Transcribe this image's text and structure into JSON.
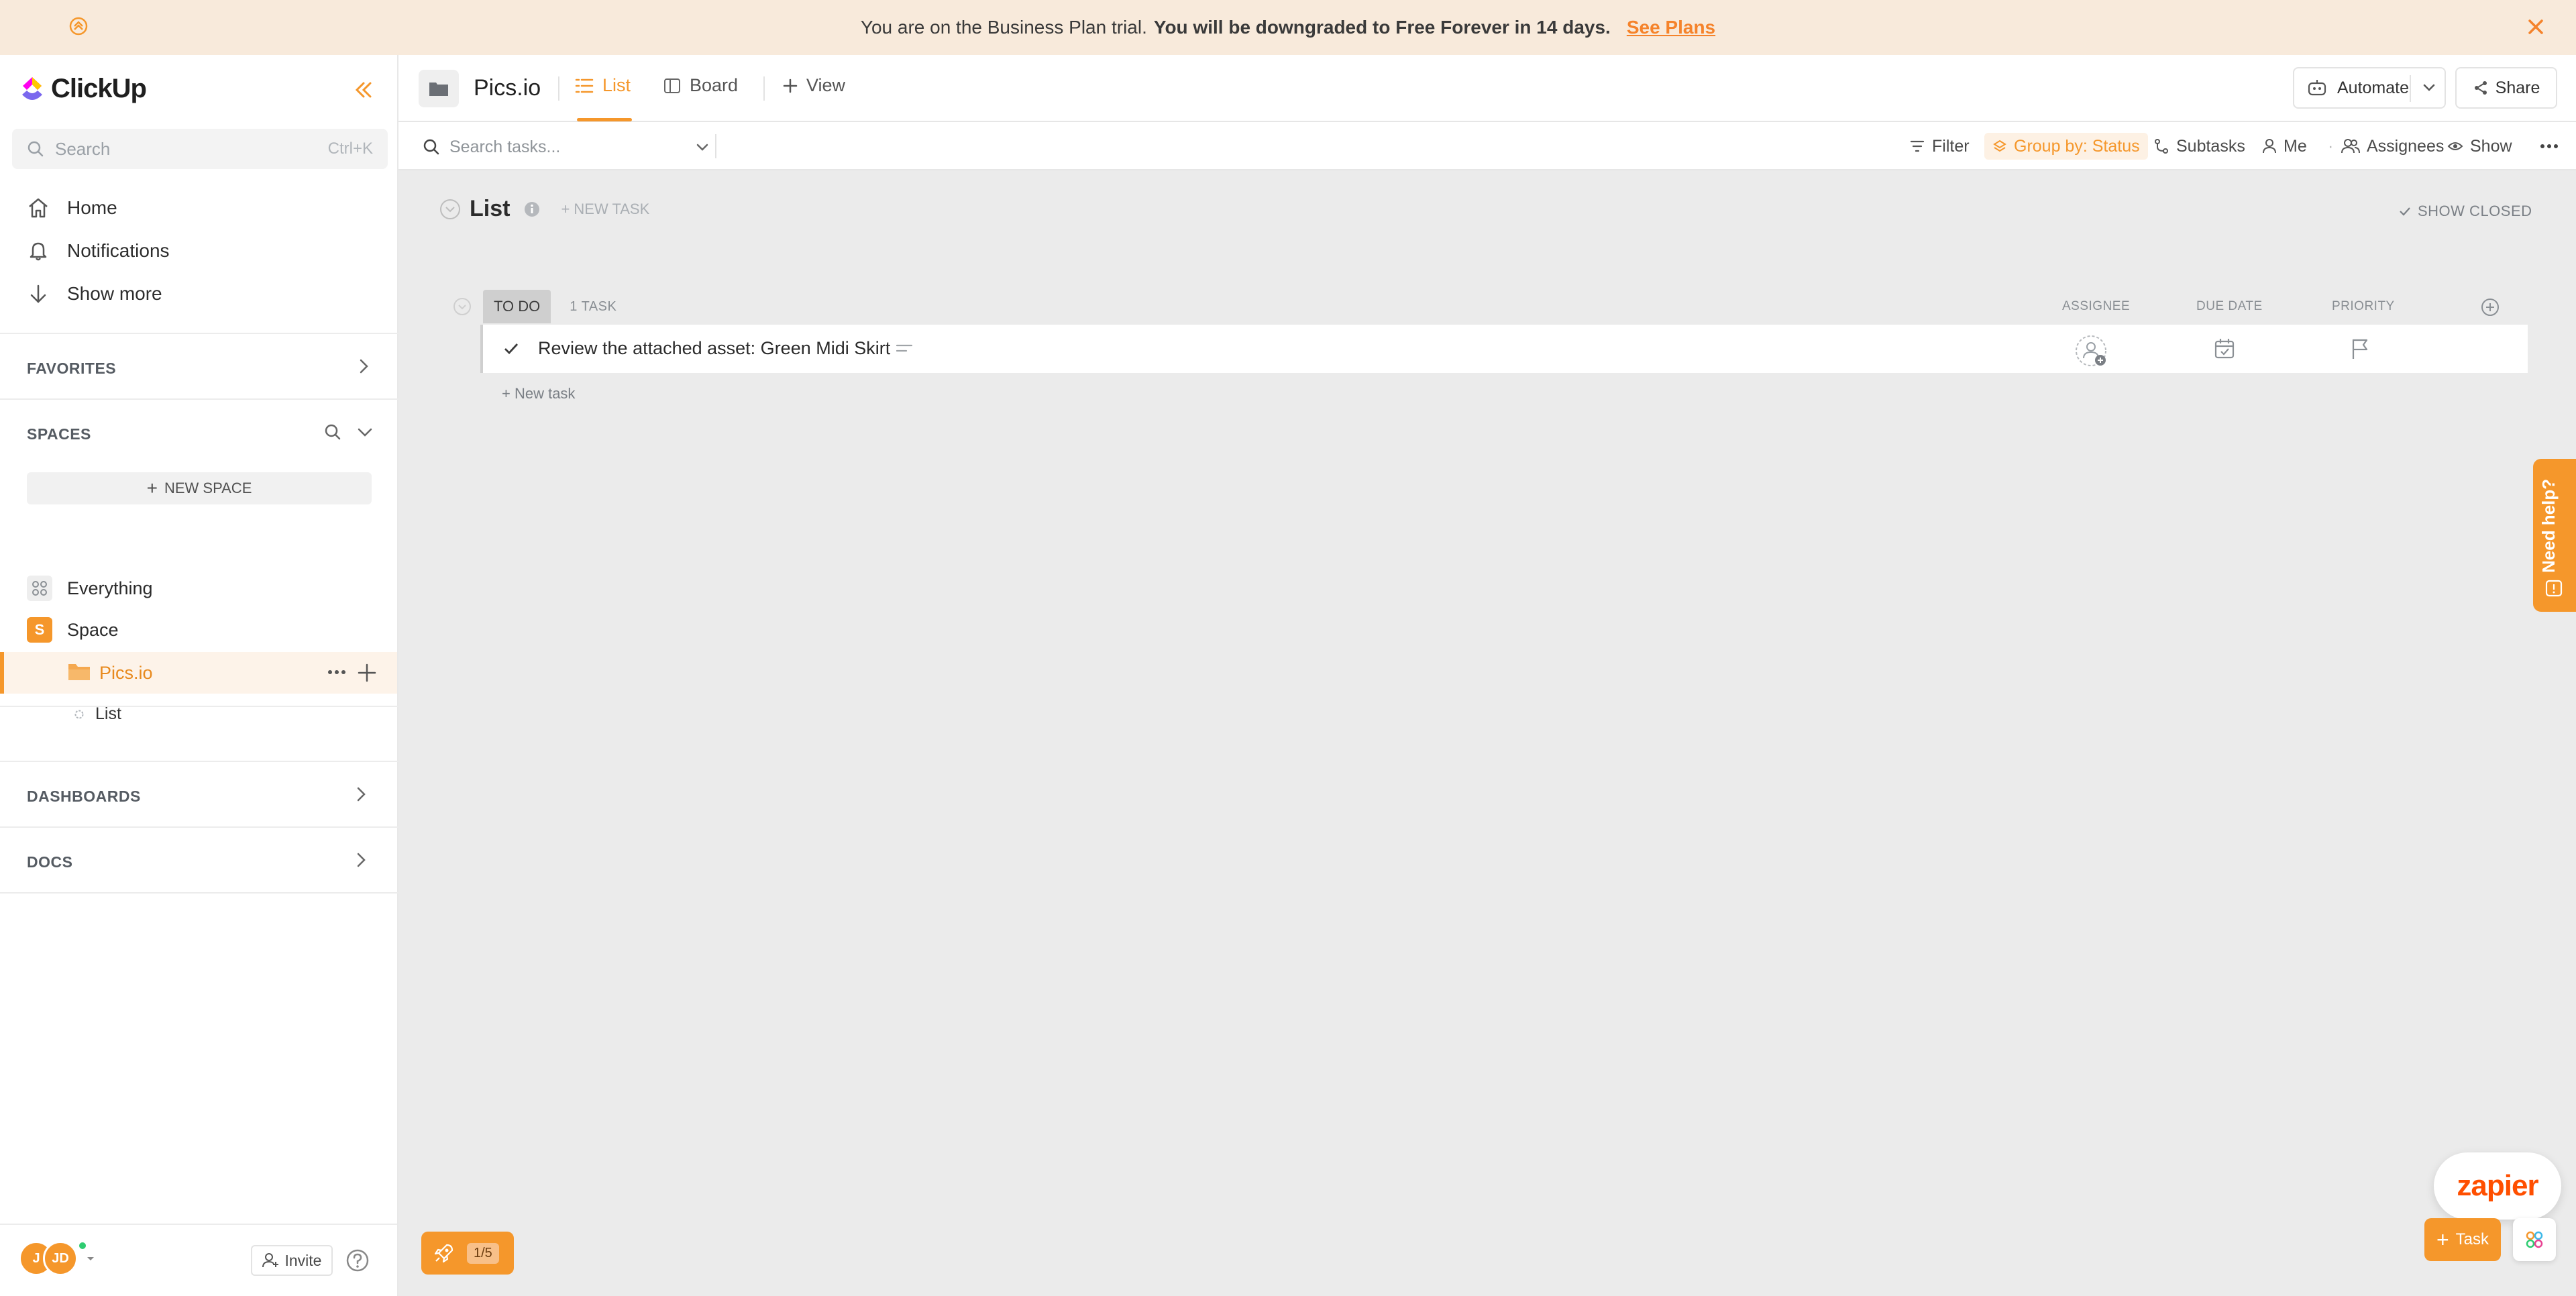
{
  "banner": {
    "text": "You are on the Business Plan trial.",
    "strong": "You will be downgraded to Free Forever in 14 days.",
    "link": "See Plans"
  },
  "sidebar": {
    "logo": "ClickUp",
    "search": {
      "placeholder": "Search",
      "shortcut": "Ctrl+K"
    },
    "nav": [
      {
        "label": "Home",
        "icon": "home-icon"
      },
      {
        "label": "Notifications",
        "icon": "bell-icon"
      },
      {
        "label": "Show more",
        "icon": "arrow-down-icon"
      }
    ],
    "favorites": "FAVORITES",
    "spaces": "SPACES",
    "new_space": "NEW SPACE",
    "everything": "Everything",
    "space": {
      "label": "Space",
      "badge": "S"
    },
    "folder": "Pics.io",
    "list": "List",
    "dashboards": "DASHBOARDS",
    "docs": "DOCS",
    "avatars": [
      "J",
      "JD"
    ],
    "invite": "Invite"
  },
  "topbar": {
    "title": "Pics.io",
    "tabs": [
      {
        "label": "List",
        "active": true
      },
      {
        "label": "Board",
        "active": false
      },
      {
        "label": "View",
        "active": false
      }
    ],
    "automate": "Automate",
    "share": "Share"
  },
  "filterbar": {
    "search_placeholder": "Search tasks...",
    "filter": "Filter",
    "group_by": "Group by: Status",
    "subtasks": "Subtasks",
    "me": "Me",
    "assignees": "Assignees",
    "show": "Show"
  },
  "list": {
    "title": "List",
    "new_task_top": "+ NEW TASK",
    "show_closed": "SHOW CLOSED",
    "group": {
      "status": "TO DO",
      "count": "1 TASK"
    },
    "columns": {
      "assignee": "ASSIGNEE",
      "due_date": "DUE DATE",
      "priority": "PRIORITY"
    },
    "tasks": [
      {
        "name": "Review the attached asset: Green Midi Skirt"
      }
    ],
    "new_task_bottom": "+ New task"
  },
  "widgets": {
    "need_help": "Need help?",
    "progress": "1/5",
    "zapier": "zapier",
    "task_button": "Task"
  },
  "colors": {
    "accent": "#f5972b",
    "banner_bg": "#f8eadb",
    "zapier": "#ff4f00"
  }
}
